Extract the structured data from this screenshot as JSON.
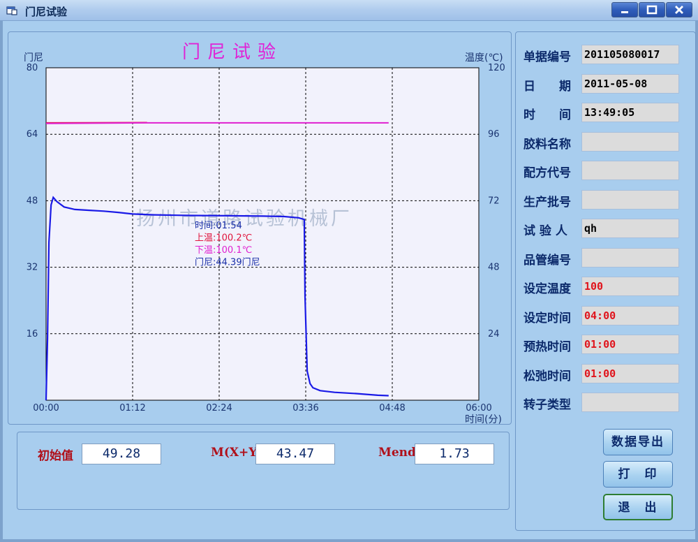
{
  "window": {
    "title": "门尼试验",
    "icons": {
      "app": "window-app-icon",
      "minimize": "minimize-icon",
      "maximize": "maximize-icon",
      "close": "close-icon"
    }
  },
  "chart_data": {
    "type": "line",
    "title": "门尼试验",
    "ylabel_left": "门尼",
    "ylabel_right": "温度(℃)",
    "xlabel": "时间(分)",
    "x_tick_labels": [
      "00:00",
      "01:12",
      "02:24",
      "03:36",
      "04:48",
      "06:00"
    ],
    "y_left_ticks": [
      80,
      64,
      48,
      32,
      16
    ],
    "y_right_ticks": [
      120,
      96,
      72,
      48,
      24
    ],
    "xlim_minutes": [
      0,
      6
    ],
    "ylim_left": [
      0,
      80
    ],
    "ylim_right": [
      0,
      120
    ],
    "grid": true,
    "watermark": "扬州市道路试验机械厂",
    "series": [
      {
        "name": "门尼",
        "axis": "left",
        "color": "#1a1ae6",
        "x": [
          0.0,
          0.02,
          0.04,
          0.07,
          0.1,
          0.15,
          0.25,
          0.4,
          0.6,
          0.8,
          1.0,
          1.2,
          1.5,
          2.0,
          2.5,
          3.0,
          3.3,
          3.5,
          3.58,
          3.59,
          3.62,
          3.66,
          3.7,
          3.8,
          4.0,
          4.3,
          4.6,
          4.75
        ],
        "y": [
          0.0,
          15.0,
          38.0,
          47.0,
          48.8,
          47.8,
          46.5,
          45.9,
          45.7,
          45.5,
          45.2,
          44.8,
          44.6,
          44.45,
          44.39,
          44.3,
          44.2,
          43.9,
          43.5,
          25.0,
          7.0,
          4.0,
          3.0,
          2.3,
          1.9,
          1.6,
          1.2,
          1.1
        ]
      },
      {
        "name": "上温",
        "axis": "right",
        "color": "#e0143c",
        "x": [
          0.0,
          1.4
        ],
        "y": [
          100.1,
          100.2
        ]
      },
      {
        "name": "下温",
        "axis": "right",
        "color": "#e020d0",
        "x": [
          0.0,
          1.4,
          4.75
        ],
        "y": [
          99.9,
          100.1,
          100.1
        ]
      }
    ],
    "tooltip": {
      "time": "时间:01:54",
      "upper_temp": "上温:100.2℃",
      "lower_temp": "下温:100.1℃",
      "mooney": "门尼:44.39门尼"
    }
  },
  "info": {
    "fields": [
      {
        "label": "单据编号",
        "value": "201105080017",
        "red": false
      },
      {
        "label": "日　　期",
        "value": "2011-05-08",
        "red": false
      },
      {
        "label": "时　　间",
        "value": "13:49:05",
        "red": false
      },
      {
        "label": "胶料名称",
        "value": "",
        "red": false
      },
      {
        "label": "配方代号",
        "value": "",
        "red": false
      },
      {
        "label": "生产批号",
        "value": "",
        "red": false
      },
      {
        "label": "试 验 人",
        "value": "qh",
        "red": false
      },
      {
        "label": "品管编号",
        "value": "",
        "red": false
      },
      {
        "label": "设定温度",
        "value": "100",
        "red": true
      },
      {
        "label": "设定时间",
        "value": "04:00",
        "red": true
      },
      {
        "label": "预热时间",
        "value": "01:00",
        "red": true
      },
      {
        "label": "松弛时间",
        "value": "01:00",
        "red": true
      },
      {
        "label": "转子类型",
        "value": "",
        "red": false
      }
    ]
  },
  "buttons": {
    "export": "数据导出",
    "print": "打　印",
    "exit": "退　出"
  },
  "results": {
    "initial_label": "初始值",
    "initial_value": "49.28",
    "m_label": "M(X+Y)",
    "m_value": "43.47",
    "mend_label": "Mend",
    "mend_value": "1.73"
  }
}
